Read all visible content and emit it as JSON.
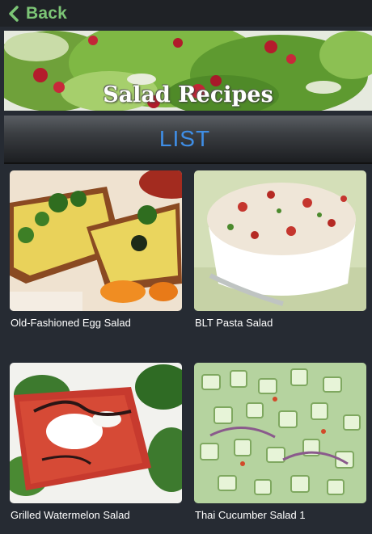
{
  "nav": {
    "back_label": "Back"
  },
  "banner": {
    "title": "Salad Recipes"
  },
  "list": {
    "title": "LIST"
  },
  "recipes": [
    {
      "name": "Old-Fashioned Egg Salad"
    },
    {
      "name": "BLT Pasta Salad"
    },
    {
      "name": "Grilled Watermelon Salad"
    },
    {
      "name": "Thai Cucumber Salad 1"
    }
  ],
  "colors": {
    "accent_green": "#7cc576",
    "list_blue": "#3f8ee6",
    "background": "#262b33"
  }
}
